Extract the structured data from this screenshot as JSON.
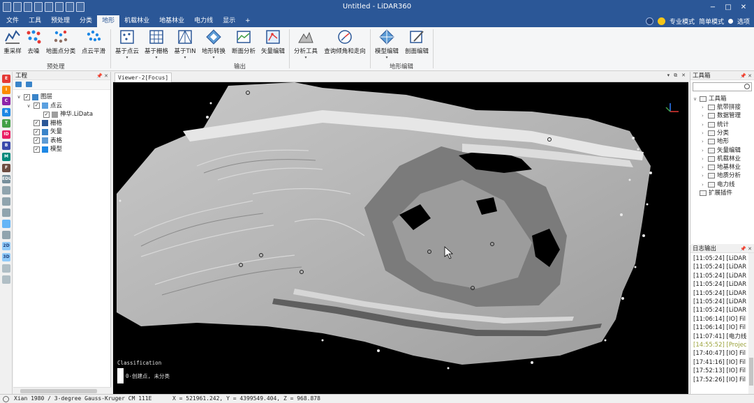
{
  "app": {
    "title": "Untitled - LiDAR360"
  },
  "menu": {
    "tabs": [
      "文件",
      "工具",
      "预处理",
      "分类",
      "地形",
      "机载林业",
      "地基林业",
      "电力线",
      "显示",
      "+"
    ],
    "active_tab": "地形",
    "right": {
      "pro_mode": "专业模式",
      "simple_mode": "简单模式",
      "options": "选项"
    }
  },
  "ribbon": {
    "groups": [
      {
        "label": "预处理",
        "buttons": [
          "重采样",
          "去噪",
          "地面点分类",
          "点云平滑"
        ]
      },
      {
        "label": "输出",
        "buttons": [
          "基于点云",
          "基于栅格",
          "基于TIN",
          "地形转换",
          "断面分析",
          "矢量编辑"
        ]
      },
      {
        "label": "",
        "buttons": [
          "分析工具",
          "查询倾角和走向"
        ]
      },
      {
        "label": "地形编辑",
        "buttons": [
          "模型编辑",
          "剖面编辑"
        ]
      }
    ]
  },
  "project_panel": {
    "title": "工程",
    "tree": [
      {
        "label": "图层",
        "level": 0,
        "icon": "layers-icon"
      },
      {
        "label": "点云",
        "level": 1,
        "icon": "point-cloud-icon"
      },
      {
        "label": "神华.LiData",
        "level": 2,
        "icon": "lidata-file-icon"
      },
      {
        "label": "栅格",
        "level": 1,
        "icon": "raster-icon"
      },
      {
        "label": "矢量",
        "level": 1,
        "icon": "vector-icon"
      },
      {
        "label": "表格",
        "level": 1,
        "icon": "table-icon"
      },
      {
        "label": "模型",
        "level": 1,
        "icon": "model-icon"
      }
    ]
  },
  "viewer": {
    "tab_label": "Viewer-2[Focus]",
    "legend_title": "Classification",
    "legend_item": "0-创建点, 未分类"
  },
  "toolbox": {
    "title": "工具箱",
    "root": "工具箱",
    "items": [
      "航带拼接",
      "数据管理",
      "统计",
      "分类",
      "地形",
      "矢量编辑",
      "机载林业",
      "地基林业",
      "地质分析",
      "电力线"
    ],
    "extensions": "扩展插件"
  },
  "log": {
    "title": "日志输出",
    "lines": [
      {
        "text": "[11:05:24] [LiDAR3",
        "color": "#222222"
      },
      {
        "text": "[11:05:24] [LiDAR3",
        "color": "#222222"
      },
      {
        "text": "[11:05:24] [LiDAR3",
        "color": "#222222"
      },
      {
        "text": "[11:05:24] [LiDAR3",
        "color": "#222222"
      },
      {
        "text": "[11:05:24] [LiDAR3",
        "color": "#222222"
      },
      {
        "text": "[11:05:24] [LiDAR3",
        "color": "#222222"
      },
      {
        "text": "[11:05:24] [LiDAR3",
        "color": "#222222"
      },
      {
        "text": "[11:06:14] [IO]    Fil",
        "color": "#222222"
      },
      {
        "text": "[11:06:14] [IO]    Fil",
        "color": "#222222"
      },
      {
        "text": "[11:07:41] [电力线]",
        "color": "#222222"
      },
      {
        "text": "[14:55:52] [Project",
        "color": "#9aa23a"
      },
      {
        "text": "[17:40:47] [IO]    Fil",
        "color": "#222222"
      },
      {
        "text": "[17:41:16] [IO]    Fil",
        "color": "#222222"
      },
      {
        "text": "[17:52:13] [IO]    Fil",
        "color": "#222222"
      },
      {
        "text": "[17:52:26] [IO]    Fil",
        "color": "#222222"
      }
    ]
  },
  "status": {
    "crs": "Xian 1980 / 3-degree Gauss-Kruger CM 111E",
    "coords": "X = 521961.242, Y = 4399549.404, Z = 968.878"
  },
  "colors": {
    "brand": "#2b5797",
    "viewer_bg": "#000000",
    "log_highlight": "#9aa23a"
  }
}
